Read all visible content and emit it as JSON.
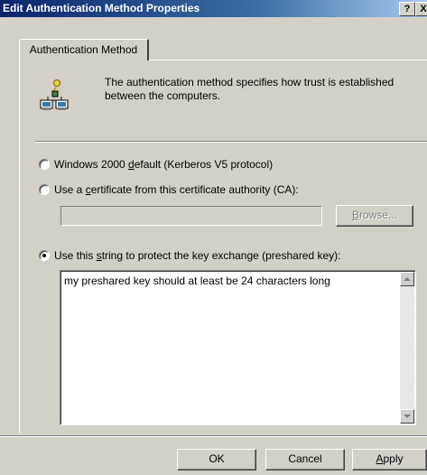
{
  "window": {
    "title": "Edit Authentication Method Properties",
    "help_label": "?",
    "close_label": "X"
  },
  "tab": {
    "label": "Authentication Method"
  },
  "description": "The authentication method specifies how trust is established between the computers.",
  "options": {
    "kerberos": {
      "pre": "Windows 2000 ",
      "accel": "d",
      "post": "efault (Kerberos V5 protocol)",
      "selected": false
    },
    "certificate": {
      "pre": "Use a ",
      "accel": "c",
      "post": "ertificate from this certificate authority (CA):",
      "selected": false
    },
    "preshared": {
      "pre": "Use this ",
      "accel": "s",
      "post": "tring to protect the key exchange (preshared key):",
      "selected": true
    }
  },
  "ca_field": {
    "value": ""
  },
  "browse_button": {
    "pre": "",
    "accel": "B",
    "post": "rowse...",
    "enabled": false
  },
  "preshared_key": {
    "value": "my preshared key should at least be 24 characters long"
  },
  "buttons": {
    "ok": "OK",
    "cancel": "Cancel",
    "apply": {
      "pre": "",
      "accel": "A",
      "post": "pply"
    }
  },
  "icons": {
    "auth_icon": "network-computers-key-icon",
    "scroll_up": "arrow-up-icon",
    "scroll_down": "arrow-down-icon"
  }
}
